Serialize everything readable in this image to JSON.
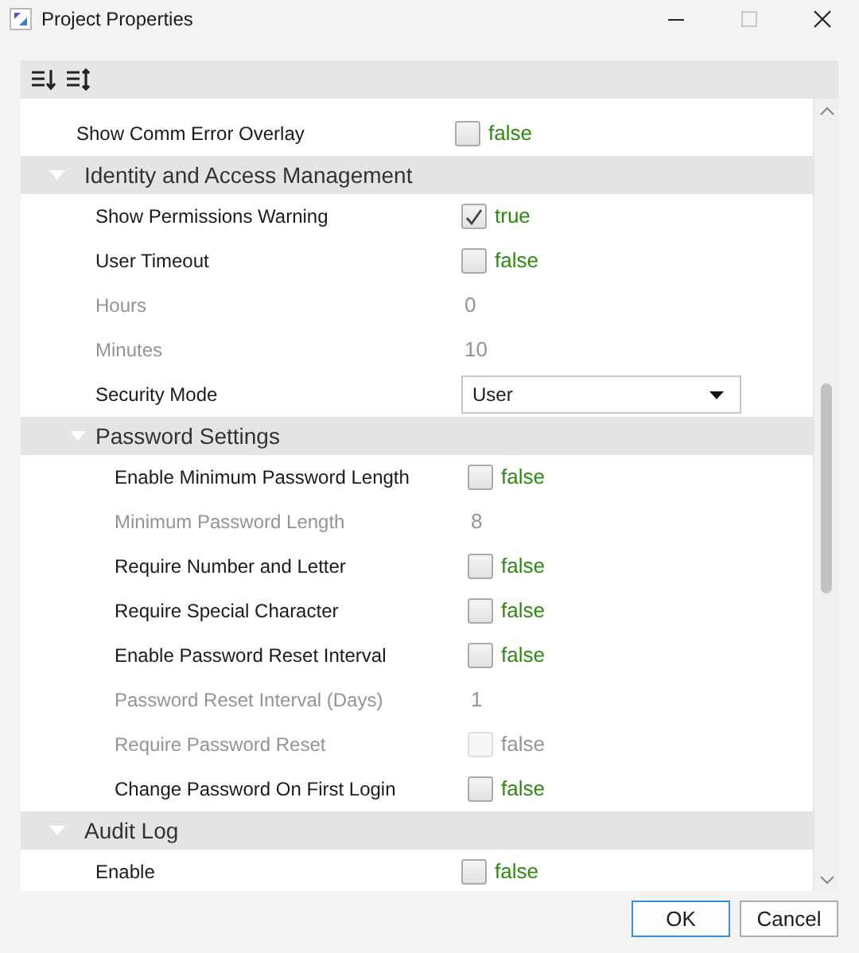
{
  "window": {
    "title": "Project Properties"
  },
  "properties": [
    {
      "kind": "bool",
      "label": "Show Comm Error Overlay",
      "checked": false,
      "disabled": false,
      "value": "false"
    },
    {
      "kind": "group",
      "label": "Identity and Access Management",
      "expanded": true,
      "children": [
        {
          "kind": "bool",
          "label": "Show Permissions Warning",
          "checked": true,
          "disabled": false,
          "value": "true"
        },
        {
          "kind": "bool",
          "label": "User Timeout",
          "checked": false,
          "disabled": false,
          "value": "false"
        },
        {
          "kind": "number",
          "label": "Hours",
          "disabled": true,
          "value": "0"
        },
        {
          "kind": "number",
          "label": "Minutes",
          "disabled": true,
          "value": "10"
        },
        {
          "kind": "select",
          "label": "Security Mode",
          "disabled": false,
          "value": "User"
        },
        {
          "kind": "group",
          "label": "Password Settings",
          "expanded": true,
          "children": [
            {
              "kind": "bool",
              "label": "Enable Minimum Password Length",
              "checked": false,
              "disabled": false,
              "value": "false"
            },
            {
              "kind": "number",
              "label": "Minimum Password Length",
              "disabled": true,
              "value": "8"
            },
            {
              "kind": "bool",
              "label": "Require Number and Letter",
              "checked": false,
              "disabled": false,
              "value": "false"
            },
            {
              "kind": "bool",
              "label": "Require Special Character",
              "checked": false,
              "disabled": false,
              "value": "false"
            },
            {
              "kind": "bool",
              "label": "Enable Password Reset Interval",
              "checked": false,
              "disabled": false,
              "value": "false"
            },
            {
              "kind": "number",
              "label": "Password Reset Interval (Days)",
              "disabled": true,
              "value": "1"
            },
            {
              "kind": "bool",
              "label": "Require Password Reset",
              "checked": false,
              "disabled": true,
              "value": "false"
            },
            {
              "kind": "bool",
              "label": "Change Password On First Login",
              "checked": false,
              "disabled": false,
              "value": "false"
            }
          ]
        }
      ]
    },
    {
      "kind": "group",
      "label": "Audit Log",
      "expanded": true,
      "children": [
        {
          "kind": "bool",
          "label": "Enable",
          "checked": false,
          "disabled": false,
          "value": "false"
        }
      ]
    }
  ],
  "buttons": [
    {
      "label": "OK",
      "default": true
    },
    {
      "label": "Cancel",
      "default": false
    }
  ]
}
